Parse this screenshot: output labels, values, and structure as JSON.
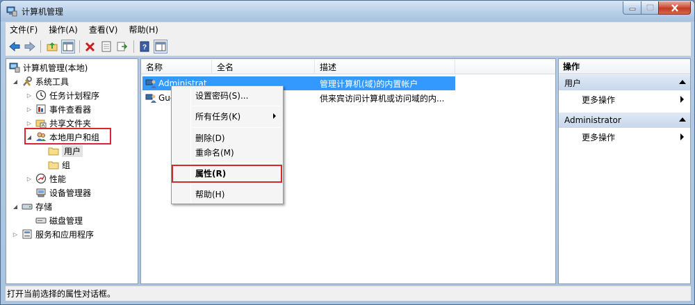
{
  "window": {
    "title": "计算机管理"
  },
  "menu": [
    "文件(F)",
    "操作(A)",
    "查看(V)",
    "帮助(H)"
  ],
  "tree": {
    "root": "计算机管理(本地)",
    "system_tools": "系统工具",
    "task_scheduler": "任务计划程序",
    "event_viewer": "事件查看器",
    "shared_folders": "共享文件夹",
    "local_users_groups": "本地用户和组",
    "users": "用户",
    "groups": "组",
    "performance": "性能",
    "device_manager": "设备管理器",
    "storage": "存储",
    "disk_management": "磁盘管理",
    "services_apps": "服务和应用程序"
  },
  "list": {
    "columns": [
      "名称",
      "全名",
      "描述"
    ],
    "rows": [
      {
        "name": "Administrat",
        "fullname": "",
        "description": "管理计算机(域)的内置帐户"
      },
      {
        "name": "Gue",
        "fullname": "",
        "description": "供来宾访问计算机或访问域的内..."
      }
    ]
  },
  "context_menu": {
    "set_password": "设置密码(S)...",
    "all_tasks": "所有任务(K)",
    "delete": "删除(D)",
    "rename": "重命名(M)",
    "properties": "属性(R)",
    "help": "帮助(H)"
  },
  "actions": {
    "title": "操作",
    "group1": "用户",
    "group1_more": "更多操作",
    "group2": "Administrator",
    "group2_more": "更多操作"
  },
  "status": "打开当前选择的属性对话框。",
  "colors": {
    "selection": "#3399ff",
    "highlight_box": "#d9262e"
  }
}
